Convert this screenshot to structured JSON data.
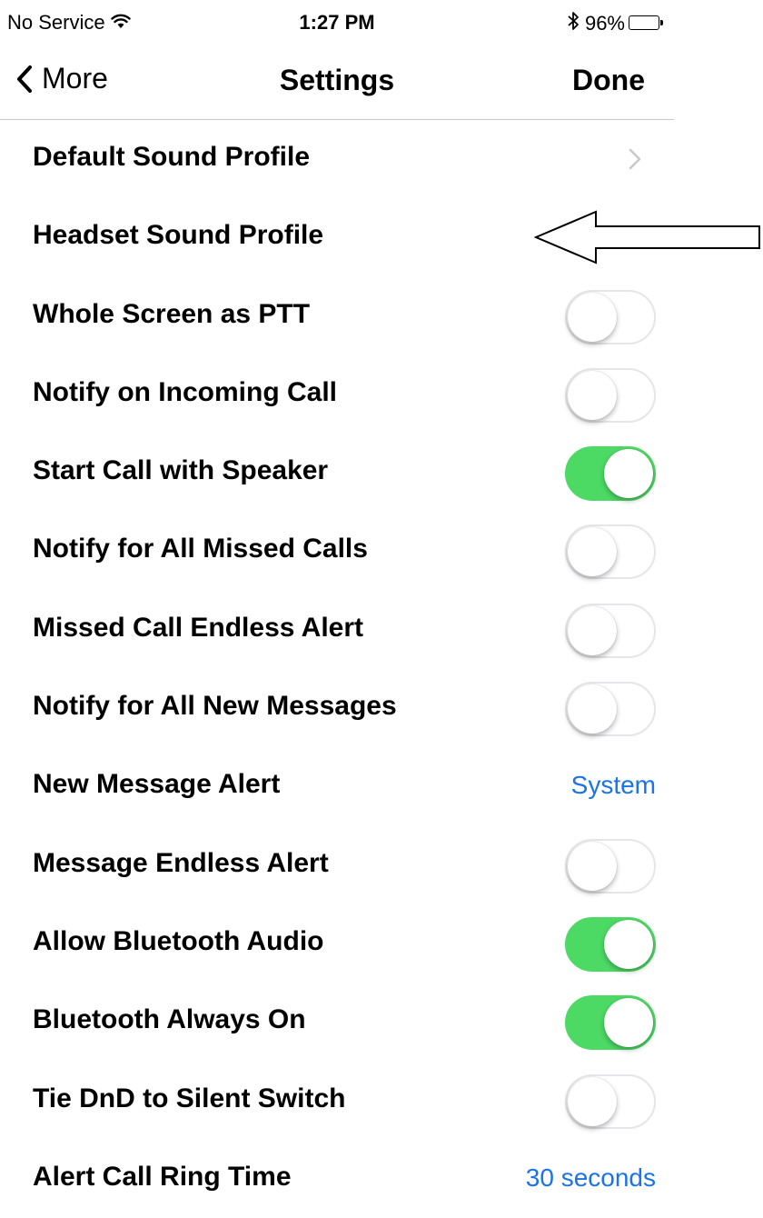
{
  "status_bar": {
    "carrier": "No Service",
    "time": "1:27 PM",
    "battery": "96%",
    "battery_level": 0.96,
    "icons": [
      "wifi-icon",
      "bluetooth-icon",
      "battery-icon"
    ]
  },
  "nav": {
    "back_label": "More",
    "title": "Settings",
    "done_label": "Done"
  },
  "colors": {
    "accent": "#1a73e8",
    "toggle_on": "#4cd964",
    "separator": "#c8c7cc"
  },
  "settings": [
    {
      "label": "Default Sound Profile",
      "type": "disclosure"
    },
    {
      "label": "Headset Sound Profile",
      "type": "plain"
    },
    {
      "label": "Whole Screen as PTT",
      "type": "toggle",
      "on": false
    },
    {
      "label": "Notify on Incoming Call",
      "type": "toggle",
      "on": false
    },
    {
      "label": "Start Call with Speaker",
      "type": "toggle",
      "on": true
    },
    {
      "label": "Notify for All Missed Calls",
      "type": "toggle",
      "on": false
    },
    {
      "label": "Missed Call Endless Alert",
      "type": "toggle",
      "on": false
    },
    {
      "label": "Notify for All New Messages",
      "type": "toggle",
      "on": false
    },
    {
      "label": "New Message Alert",
      "type": "value",
      "value": "System"
    },
    {
      "label": "Message Endless Alert",
      "type": "toggle",
      "on": false
    },
    {
      "label": "Allow Bluetooth Audio",
      "type": "toggle",
      "on": true
    },
    {
      "label": "Bluetooth Always On",
      "type": "toggle",
      "on": true
    },
    {
      "label": "Tie DnD to Silent Switch",
      "type": "toggle",
      "on": false
    },
    {
      "label": "Alert Call Ring Time",
      "type": "value",
      "value": "30 seconds"
    }
  ]
}
